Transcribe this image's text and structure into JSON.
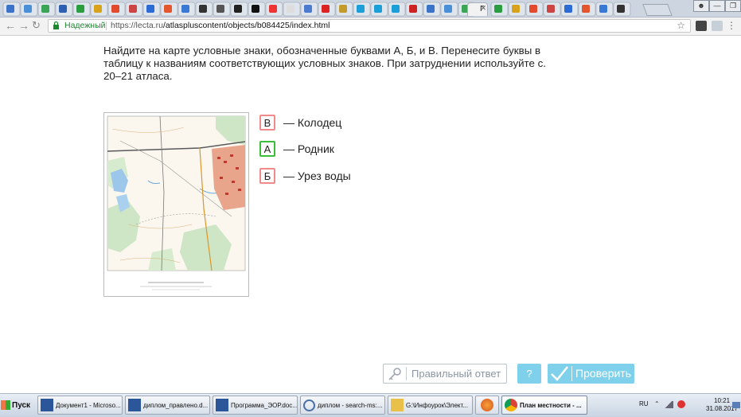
{
  "browser": {
    "active_tab_title": "Г",
    "secure_label": "Надежный",
    "url_host": "https://lecta.ru",
    "url_path": "/atlaspluscontent/objects/b084425/index.html",
    "icons": [
      "back-icon",
      "forward-icon",
      "reload-icon",
      "lock-icon",
      "star-icon"
    ]
  },
  "task": {
    "question": "Найдите на карте условные знаки, обозначенные буквами А, Б, и В. Перенесите буквы в таблицу к названиям соответствующих условных знаков. При затруднении используйте с. 20–21 атласа.",
    "answers": [
      {
        "letter": "В",
        "label": "— Колодец",
        "status": "incorrect"
      },
      {
        "letter": "А",
        "label": "— Родник",
        "status": "correct"
      },
      {
        "letter": "Б",
        "label": "— Урез воды",
        "status": "incorrect"
      }
    ],
    "show_answer_label": "Правильный ответ",
    "help_label": "?",
    "check_label": "Проверить"
  },
  "colors": {
    "correct": "#37c037",
    "incorrect": "#ef8b8b",
    "button": "#7fd0ea",
    "secure": "#1a8a2e"
  },
  "taskbar": {
    "start_label": "Пуск",
    "items": [
      {
        "label": "Документ1 - Microso..."
      },
      {
        "label": "диплом_правлено.d..."
      },
      {
        "label": "Программа_ЭОР.doc..."
      },
      {
        "label": "диплом - search-ms:..."
      },
      {
        "label": "G:\\Инфоурок\\Элект..."
      },
      {
        "label": ""
      },
      {
        "label": "План местности - ..."
      }
    ],
    "lang": "RU",
    "time": "10:21",
    "date": "31.08.2017"
  }
}
